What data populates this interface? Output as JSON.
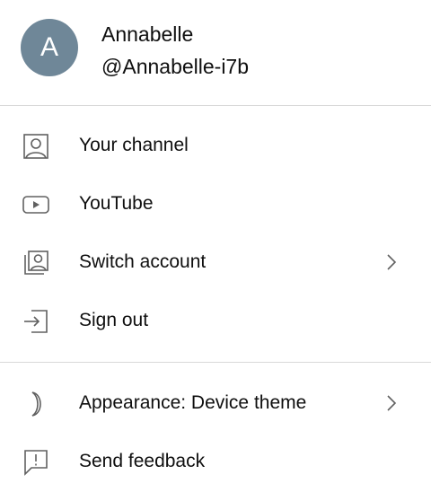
{
  "account": {
    "avatar_initial": "A",
    "avatar_color": "#6f8798",
    "name": "Annabelle",
    "handle": "@Annabelle-i7b"
  },
  "menu": {
    "your_channel": {
      "label": "Your channel",
      "icon": "person-box-icon"
    },
    "youtube": {
      "label": "YouTube",
      "icon": "play-box-icon"
    },
    "switch_account": {
      "label": "Switch account",
      "icon": "switch-account-icon",
      "has_submenu": true
    },
    "sign_out": {
      "label": "Sign out",
      "icon": "sign-out-icon"
    },
    "appearance": {
      "label": "Appearance: Device theme",
      "icon": "moon-icon",
      "has_submenu": true
    },
    "send_feedback": {
      "label": "Send feedback",
      "icon": "feedback-icon"
    }
  }
}
